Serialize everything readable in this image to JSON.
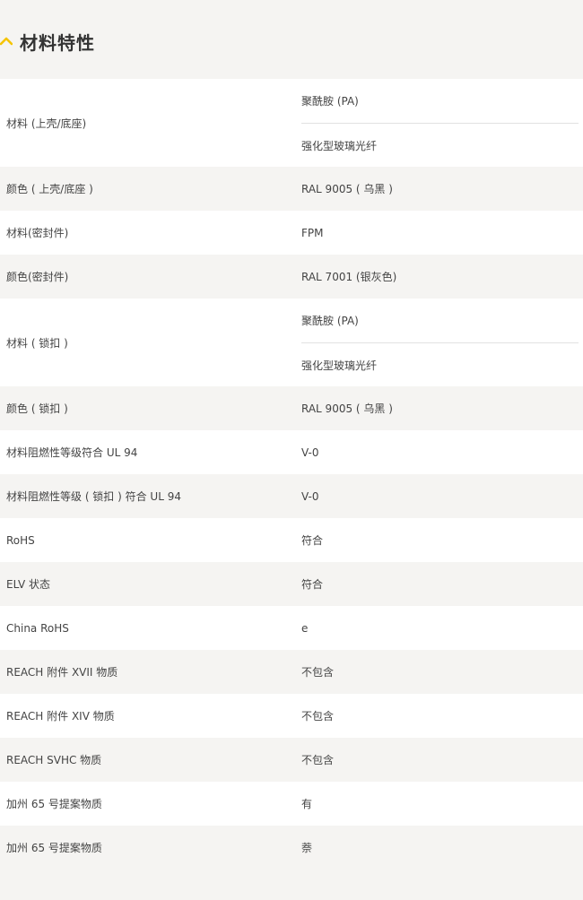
{
  "section": {
    "title": "材料特性",
    "accent_color": "#f5c400"
  },
  "rows": [
    {
      "label": "材料 (上壳/底座)",
      "values": [
        "聚酰胺 (PA)",
        "强化型玻璃光纤"
      ]
    },
    {
      "label": "颜色 ( 上壳/底座 )",
      "values": [
        "RAL 9005 ( 乌黑 )"
      ]
    },
    {
      "label": "材料(密封件)",
      "values": [
        "FPM"
      ]
    },
    {
      "label": "颜色(密封件)",
      "values": [
        "RAL 7001 (银灰色)"
      ]
    },
    {
      "label": "材料 ( 锁扣 )",
      "values": [
        "聚酰胺 (PA)",
        "强化型玻璃光纤"
      ]
    },
    {
      "label": "颜色 ( 锁扣 )",
      "values": [
        "RAL 9005 ( 乌黑 )"
      ]
    },
    {
      "label": "材料阻燃性等级符合 UL 94",
      "values": [
        "V-0"
      ]
    },
    {
      "label": "材料阻燃性等级 ( 锁扣 ) 符合 UL 94",
      "values": [
        "V-0"
      ]
    },
    {
      "label": "RoHS",
      "values": [
        "符合"
      ]
    },
    {
      "label": "ELV 状态",
      "values": [
        "符合"
      ]
    },
    {
      "label": "China RoHS",
      "values": [
        "e"
      ]
    },
    {
      "label": "REACH 附件 XVII 物质",
      "values": [
        "不包含"
      ]
    },
    {
      "label": "REACH 附件 XIV 物质",
      "values": [
        "不包含"
      ]
    },
    {
      "label": "REACH SVHC 物质",
      "values": [
        "不包含"
      ]
    },
    {
      "label": "加州 65 号提案物质",
      "values": [
        "有"
      ]
    },
    {
      "label": "加州 65 号提案物质",
      "values": [
        "萘"
      ]
    }
  ]
}
